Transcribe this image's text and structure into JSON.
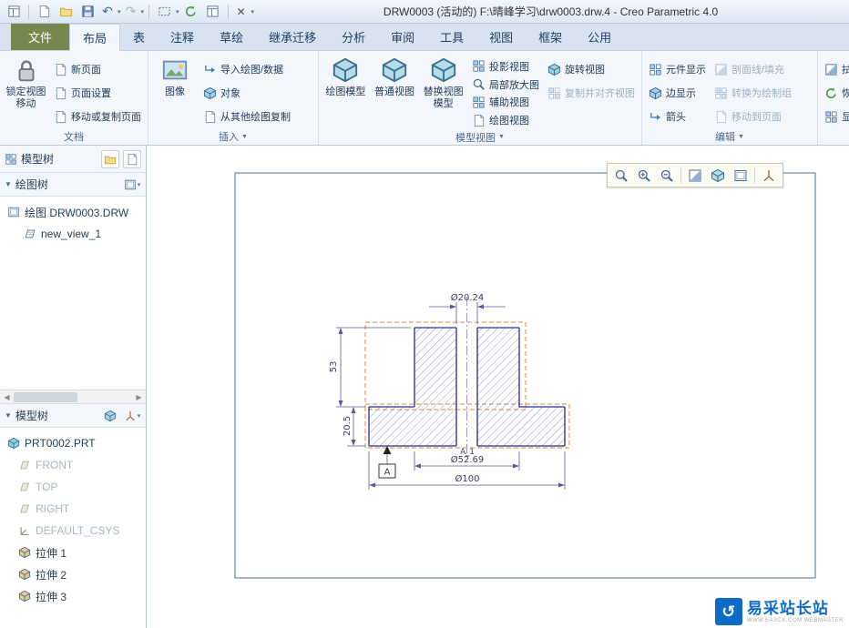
{
  "title": "DRW0003 (活动的) F:\\晴峰学习\\drw0003.drw.4 - Creo Parametric 4.0",
  "tabs": {
    "file": "文件",
    "layout": "布局",
    "table": "表",
    "annotate": "注释",
    "sketch": "草绘",
    "legacy": "继承迁移",
    "analysis": "分析",
    "review": "审阅",
    "tools": "工具",
    "view": "视图",
    "frame": "框架",
    "common": "公用"
  },
  "ribbon": {
    "doc": {
      "label": "文档",
      "lock1": "锁定视图",
      "lock2": "移动",
      "new_page": "新页面",
      "page_setup": "页面设置",
      "move_copy": "移动或复制页面"
    },
    "insert": {
      "label": "插入",
      "image": "图像",
      "import": "导入绘图/数据",
      "object": "对象",
      "copy_from": "从其他绘图复制"
    },
    "views": {
      "label": "模型视图",
      "drawing_models": "绘图模型",
      "general_view": "普通视图",
      "replace1": "替换视图",
      "replace2": "模型",
      "projection": "投影视图",
      "detailed": "局部放大图",
      "auxiliary": "辅助视图",
      "drawing_view": "绘图视图",
      "revolved": "旋转视图",
      "copy_align": "复制并对齐视图"
    },
    "edit": {
      "label": "编辑",
      "component_display": "元件显示",
      "edge_display": "边显示",
      "arrows": "箭头",
      "hatching": "剖面线/填充",
      "convert": "转换为绘制组",
      "move_to_page": "移动到页面",
      "clip1": "拭",
      "clip2": "恢",
      "clip3": "显"
    }
  },
  "panel": {
    "tree_tab": "模型树",
    "drawing_tree": "绘图树",
    "drawing_item": "绘图 DRW0003.DRW",
    "view_item": "new_view_1",
    "model_tree": "模型树",
    "part": "PRT0002.PRT",
    "front": "FRONT",
    "top": "TOP",
    "right": "RIGHT",
    "csys": "DEFAULT_CSYS",
    "ext1": "拉伸 1",
    "ext2": "拉伸 2",
    "ext3": "拉伸 3"
  },
  "drawing": {
    "dim_hole": "Ø20.24",
    "dim_height": "53",
    "dim_flange": "20.5",
    "dim_boss": "Ø52.69",
    "dim_od": "Ø100",
    "axis": "A_1",
    "datum": "A"
  },
  "watermark": {
    "brand": "易采站长站",
    "sub": "WWW.EASCK.COM WEBMASTER"
  }
}
